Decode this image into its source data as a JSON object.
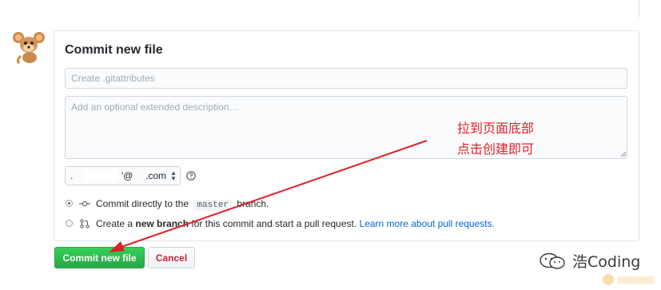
{
  "form": {
    "title": "Commit new file",
    "summary_placeholder": "Create .gitattributes",
    "description_placeholder": "Add an optional extended description…",
    "email": {
      "local": ".",
      "at": "'@",
      "domain": ".com"
    },
    "options": [
      {
        "prefix": "Commit directly to the",
        "branch": "master",
        "suffix": "branch.",
        "checked": true
      },
      {
        "prefix": "Create a",
        "strong": "new branch",
        "suffix": "for this commit and start a pull request.",
        "link": "Learn more about pull requests.",
        "checked": false
      }
    ],
    "commit_label": "Commit new file",
    "cancel_label": "Cancel"
  },
  "annotation": {
    "line1": "拉到页面底部",
    "line2": "点击创建即可",
    "color": "#e0202a"
  },
  "watermark": {
    "text": "浩Coding"
  },
  "colors": {
    "commit_green": "#28a745",
    "cancel_red": "#cb2431",
    "link_blue": "#0366d6"
  }
}
